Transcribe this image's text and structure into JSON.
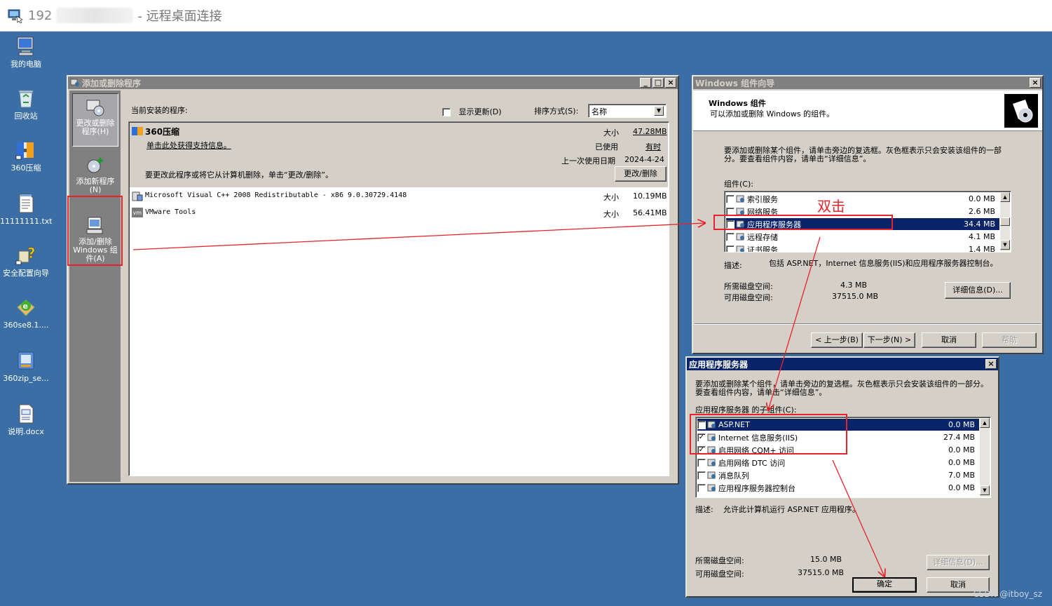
{
  "rdp": {
    "ip": "192",
    "title": "- 远程桌面连接"
  },
  "desktop_icons": [
    {
      "label": "我的电脑",
      "icon": "my-computer-icon"
    },
    {
      "label": "回收站",
      "icon": "recycle-bin-icon"
    },
    {
      "label": "360压缩",
      "icon": "archive-icon"
    },
    {
      "label": "11111111.txt",
      "icon": "text-file-icon"
    },
    {
      "label": "安全配置向导",
      "icon": "security-wizard-icon"
    },
    {
      "label": "360se8.1....",
      "icon": "browser-setup-icon"
    },
    {
      "label": "360zip_se...",
      "icon": "zip-setup-icon"
    },
    {
      "label": "说明.docx",
      "icon": "word-doc-icon"
    }
  ],
  "addremove": {
    "title": "添加或删除程序",
    "sidebar": {
      "change_remove": "更改或删除程序(H)",
      "add_new": "添加新程序(N)",
      "add_windows": "添加/删除 Windows 组件(A)"
    },
    "current_label": "当前安装的程序:",
    "show_updates": "显示更新(D)",
    "sort_label": "排序方式(S):",
    "sort_value": "名称",
    "selected_program": {
      "name": "360压缩",
      "support_link": "单击此处获得支持信息。",
      "size_label": "大小",
      "size_value": "47.28MB",
      "used_label": "已使用",
      "used_value": "有时",
      "last_used_label": "上一次使用日期",
      "last_used_value": "2024-4-24",
      "hint": "要更改此程序或将它从计算机删除，单击“更改/删除”。",
      "change_btn": "更改/删除"
    },
    "programs": [
      {
        "name": "Microsoft Visual C++ 2008 Redistributable - x86 9.0.30729.4148",
        "size_label": "大小",
        "size": "10.19MB"
      },
      {
        "name": "VMware Tools",
        "size_label": "大小",
        "size": "56.41MB"
      }
    ]
  },
  "wizard": {
    "title": "Windows 组件向导",
    "header_title": "Windows 组件",
    "header_sub": "可以添加或删除 Windows 的组件。",
    "instruction": "要添加或删除某个组件，请单击旁边的复选框。灰色框表示只会安装该组件的一部分。要查看组件内容，请单击“详细信息”。",
    "components_label": "组件(C):",
    "components": [
      {
        "name": "索引服务",
        "size": "0.0 MB",
        "checked": "",
        "selected": false
      },
      {
        "name": "网络服务",
        "size": "2.6 MB",
        "checked": "",
        "selected": false
      },
      {
        "name": "应用程序服务器",
        "size": "34.4 MB",
        "checked": "",
        "selected": true
      },
      {
        "name": "远程存储",
        "size": "4.1 MB",
        "checked": "",
        "selected": false
      },
      {
        "name": "证书服务",
        "size": "1.4 MB",
        "checked": "",
        "selected": false
      }
    ],
    "desc_label": "描述:",
    "desc_text": "包括 ASP.NET，Internet 信息服务(IIS)和应用程序服务器控制台。",
    "required_label": "所需磁盘空间:",
    "required_value": "4.3 MB",
    "available_label": "可用磁盘空间:",
    "available_value": "37515.0 MB",
    "details_btn": "详细信息(D)...",
    "back_btn": "< 上一步(B)",
    "next_btn": "下一步(N) >",
    "cancel_btn": "取消",
    "help_btn": "帮助"
  },
  "appserver": {
    "title": "应用程序服务器",
    "instruction": "要添加或删除某个组件，请单击旁边的复选框。灰色框表示只会安装该组件的一部分。要查看组件内容，请单击“详细信息”。",
    "sub_label": "应用程序服务器 的子组件(C):",
    "components": [
      {
        "name": "ASP.NET",
        "size": "0.0 MB",
        "checked": "✓",
        "selected": true
      },
      {
        "name": "Internet 信息服务(IIS)",
        "size": "27.4 MB",
        "checked": "✓",
        "selected": false
      },
      {
        "name": "启用网络 COM+ 访问",
        "size": "0.0 MB",
        "checked": "✓",
        "selected": false
      },
      {
        "name": "启用网络 DTC 访问",
        "size": "0.0 MB",
        "checked": "",
        "selected": false
      },
      {
        "name": "消息队列",
        "size": "7.0 MB",
        "checked": "",
        "selected": false
      },
      {
        "name": "应用程序服务器控制台",
        "size": "0.0 MB",
        "checked": "",
        "selected": false
      }
    ],
    "desc_label": "描述:",
    "desc_text": "允许此计算机运行 ASP.NET 应用程序。",
    "required_label": "所需磁盘空间:",
    "required_value": "15.0 MB",
    "available_label": "可用磁盘空间:",
    "available_value": "37515.0 MB",
    "details_btn": "详细信息(D)...",
    "ok_btn": "确定",
    "cancel_btn": "取消"
  },
  "annotation": {
    "double_click": "双击",
    "color": "#e8222a"
  },
  "watermark": "CSDN @itboy_sz"
}
